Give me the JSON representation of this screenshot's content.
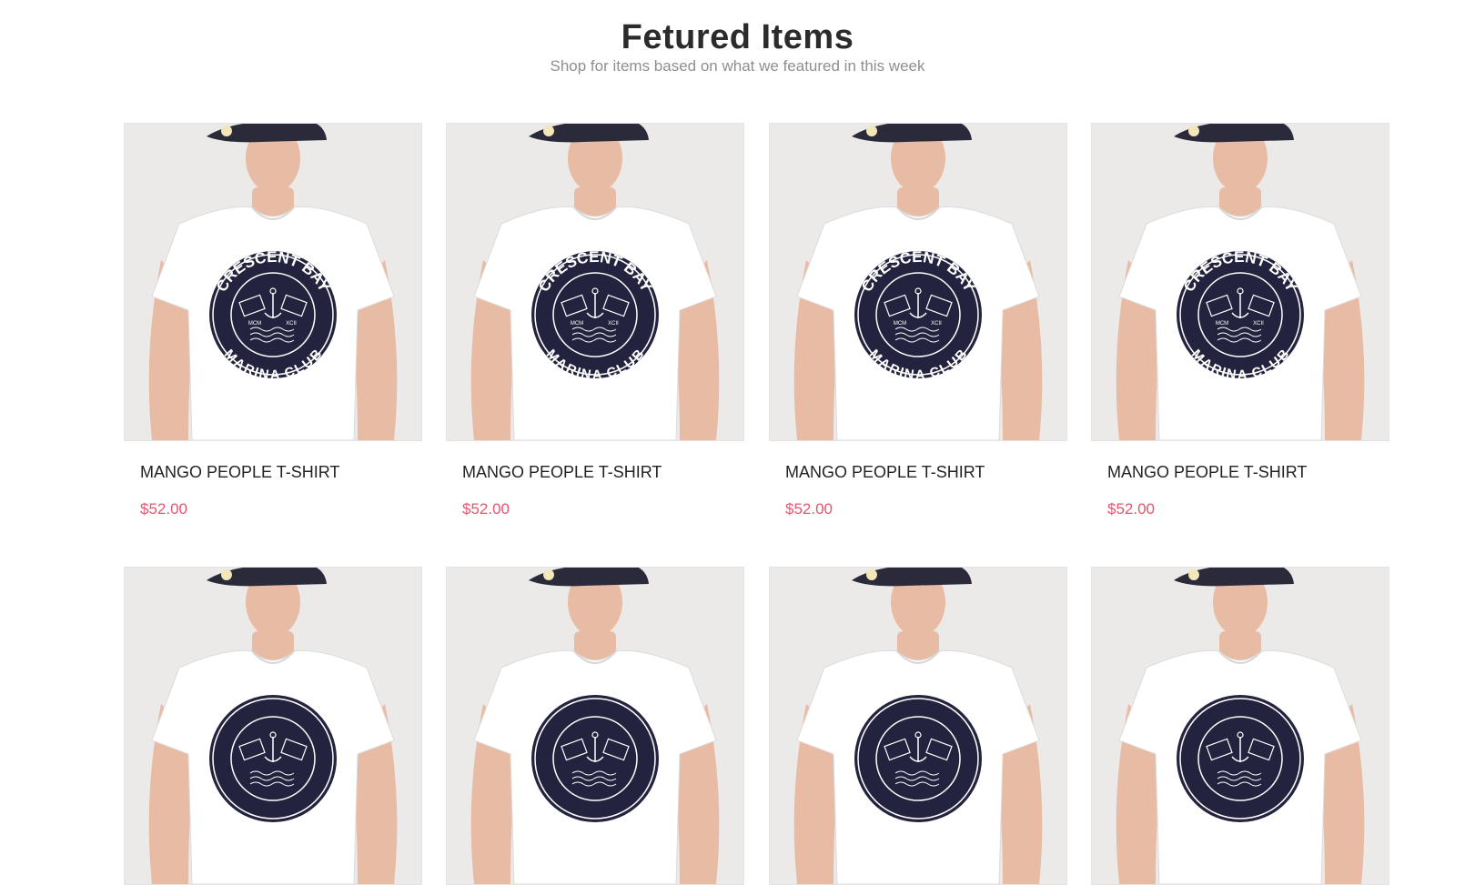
{
  "section": {
    "title": "Fetured Items",
    "subtitle": "Shop for items based on what we featured in this week"
  },
  "products": [
    {
      "name": "MANGO PEOPLE T-SHIRT",
      "price": "$52.00",
      "image_icon": "model-tshirt-image",
      "badge": {
        "top": "CRESCENT BAY",
        "bottom": "MARINA CLUB",
        "left": "MCM",
        "right": "XCII"
      }
    },
    {
      "name": "MANGO PEOPLE T-SHIRT",
      "price": "$52.00",
      "image_icon": "model-tshirt-image",
      "badge": {
        "top": "CRESCENT BAY",
        "bottom": "MARINA CLUB",
        "left": "MCM",
        "right": "XCII"
      }
    },
    {
      "name": "MANGO PEOPLE T-SHIRT",
      "price": "$52.00",
      "image_icon": "model-tshirt-image",
      "badge": {
        "top": "CRESCENT BAY",
        "bottom": "MARINA CLUB",
        "left": "MCM",
        "right": "XCII"
      }
    },
    {
      "name": "MANGO PEOPLE T-SHIRT",
      "price": "$52.00",
      "image_icon": "model-tshirt-image",
      "badge": {
        "top": "CRESCENT BAY",
        "bottom": "MARINA CLUB",
        "left": "MCM",
        "right": "XCII"
      }
    },
    {
      "name": "",
      "price": "",
      "image_icon": "model-tshirt-image",
      "badge": {
        "top": "",
        "bottom": "",
        "left": "",
        "right": ""
      }
    },
    {
      "name": "",
      "price": "",
      "image_icon": "model-tshirt-image",
      "badge": {
        "top": "",
        "bottom": "",
        "left": "",
        "right": ""
      }
    },
    {
      "name": "",
      "price": "",
      "image_icon": "model-tshirt-image",
      "badge": {
        "top": "",
        "bottom": "",
        "left": "",
        "right": ""
      }
    },
    {
      "name": "",
      "price": "",
      "image_icon": "model-tshirt-image",
      "badge": {
        "top": "",
        "bottom": "",
        "left": "",
        "right": ""
      }
    }
  ],
  "colors": {
    "price": "#e8556f",
    "title": "#2b2b2b",
    "subtitle": "#8f8f8f",
    "image_background": "#ece9e9",
    "shirt": "#ffffff",
    "badge": "#23233f",
    "cap": "#2a2a3a",
    "skin": "#e8bca4"
  }
}
